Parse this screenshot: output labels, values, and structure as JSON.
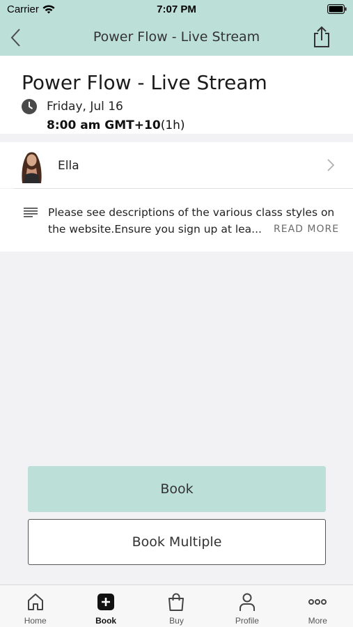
{
  "status_bar": {
    "carrier": "Carrier",
    "time": "7:07 PM"
  },
  "nav": {
    "title": "Power Flow - Live Stream",
    "back_icon": "chevron-left-icon",
    "share_icon": "share-icon"
  },
  "class": {
    "title": "Power Flow - Live Stream",
    "date": "Friday, Jul 16",
    "time_bold": "8:00 am GMT+10",
    "duration": "(1h)"
  },
  "instructor": {
    "name": "Ella"
  },
  "description": {
    "text": "Please see descriptions of the various class styles on the website.Ensure you sign up at lea...",
    "read_more": "READ MORE"
  },
  "actions": {
    "book_label": "Book",
    "book_multiple_label": "Book Multiple"
  },
  "tabs": [
    {
      "label": "Home",
      "icon": "home-icon"
    },
    {
      "label": "Book",
      "icon": "plus-square-icon",
      "active": true
    },
    {
      "label": "Buy",
      "icon": "shopping-bag-icon"
    },
    {
      "label": "Profile",
      "icon": "person-icon"
    },
    {
      "label": "More",
      "icon": "more-dots-icon"
    }
  ],
  "colors": {
    "brand_mint": "#bcdfd7",
    "background": "#f2f2f4"
  }
}
